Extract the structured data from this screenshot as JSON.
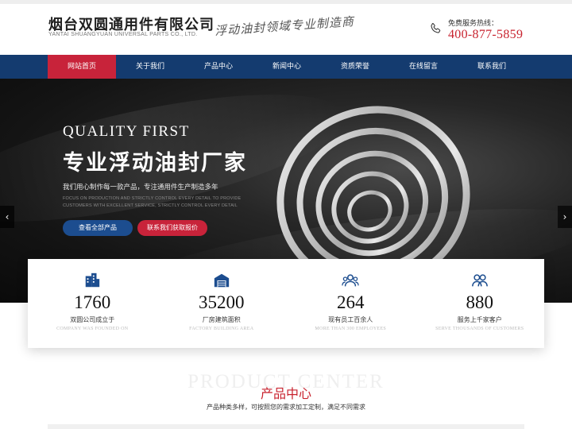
{
  "header": {
    "company_name": "烟台双圆通用件有限公司",
    "company_name_en": "YANTAI SHUANGYUAN UNIVERSAL PARTS CO., LTD.",
    "slogan": "浮动油封领域专业制造商",
    "hotline_label": "免费服务热线：",
    "hotline_number": "400-877-5859"
  },
  "nav": {
    "items": [
      "网站首页",
      "关于我们",
      "产品中心",
      "新闻中心",
      "资质荣誉",
      "在线留言",
      "联系我们"
    ],
    "active_index": 0
  },
  "banner": {
    "quality": "QUALITY  FIRST",
    "title": "专业浮动油封厂家",
    "subtitle": "我们用心制作每一款产品，专注通用件生产制造多年",
    "subtitle_en": "FOCUS ON PRODUCTION AND STRICTLY CONTROL EVERY DETAIL TO PROVIDE CUSTOMERS WITH EXCELLENT SERVICE, STRICTLY CONTROL EVERY DETAIL",
    "btn_products": "查看全部产品",
    "btn_contact": "联系我们获取报价",
    "arrow_left": "‹",
    "arrow_right": "›"
  },
  "stats": [
    {
      "icon": "building-icon",
      "number": "1760",
      "label": "双圆公司成立于",
      "label_en": "COMPANY WAS FOUNDED ON"
    },
    {
      "icon": "warehouse-icon",
      "number": "35200",
      "label": "厂房建筑面积",
      "label_en": "FACTORY BUILDING AREA"
    },
    {
      "icon": "team-icon",
      "number": "264",
      "label": "现有员工百余人",
      "label_en": "MORE THAN 300 EMPLOYEES"
    },
    {
      "icon": "customers-icon",
      "number": "880",
      "label": "服务上千家客户",
      "label_en": "SERVE THOUSANDS OF CUSTOMERS"
    }
  ],
  "product_center": {
    "bg_text": "PRODUCT CENTER",
    "title": "产品中心",
    "subtitle": "产品种类多样，可按照您的需求加工定制，满足不同需求"
  },
  "colors": {
    "nav_bg": "#143b6f",
    "accent_red": "#c8232f",
    "button_blue": "#1c4d8f"
  }
}
